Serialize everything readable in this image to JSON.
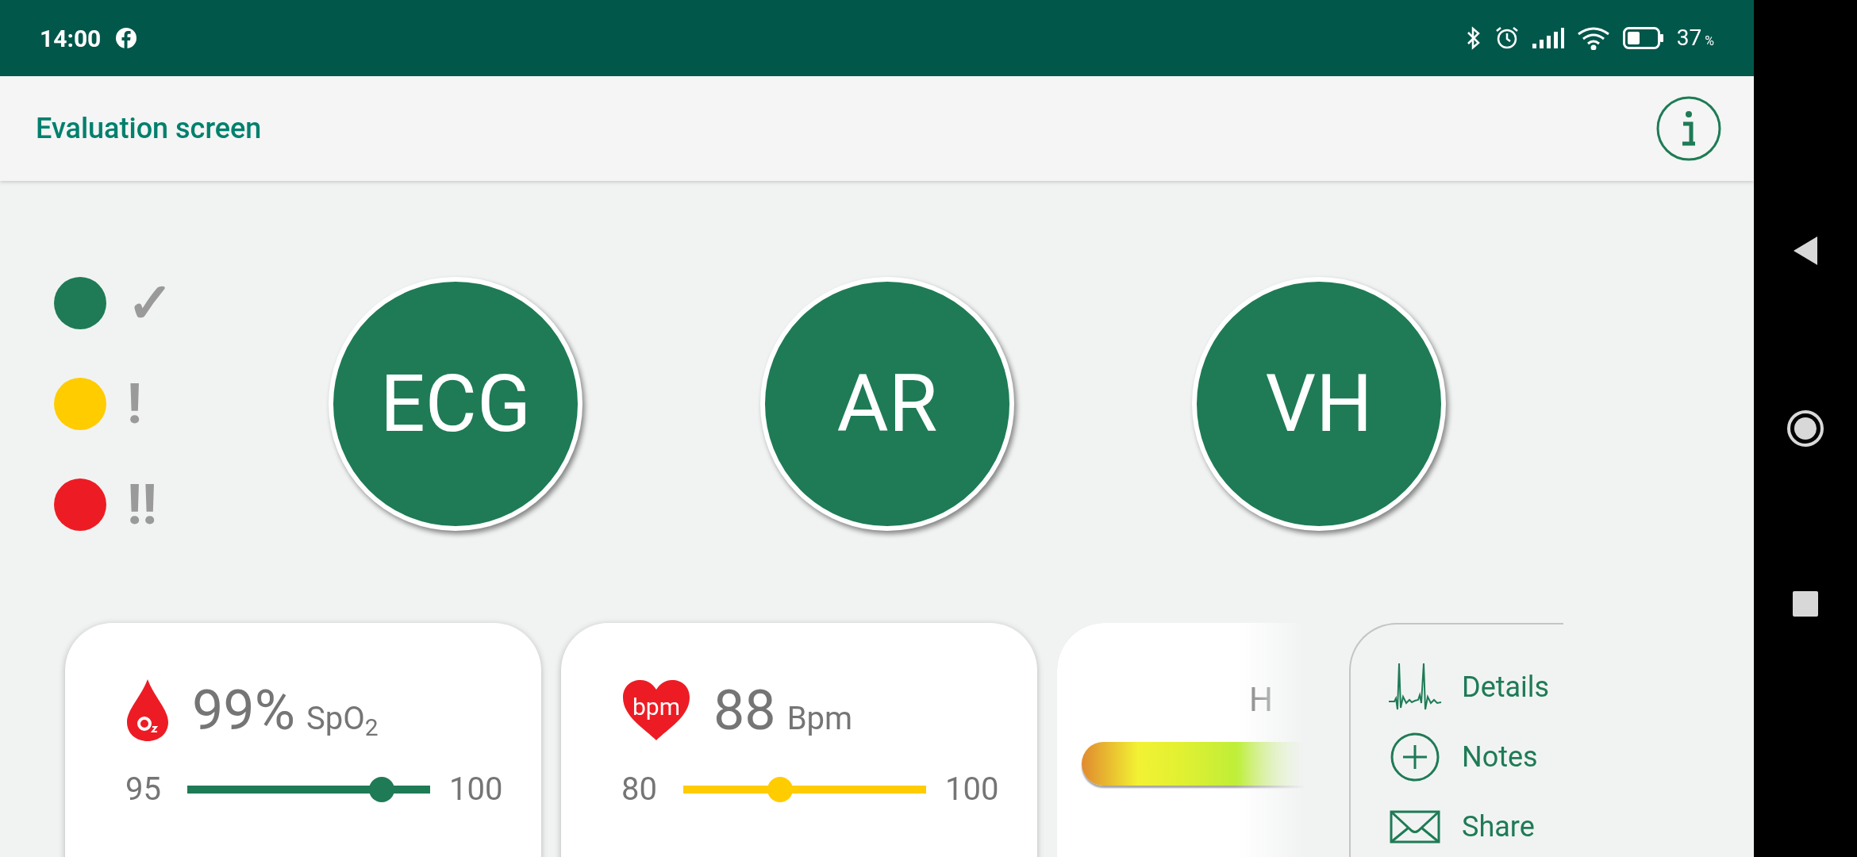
{
  "status_bar": {
    "time": "14:00",
    "battery": "37",
    "battery_unit": "%"
  },
  "app_bar": {
    "title": "Evaluation screen"
  },
  "legend": [
    {
      "color": "#1e7b56",
      "symbol": "✓"
    },
    {
      "color": "#ffcc00",
      "symbol": "!"
    },
    {
      "color": "#ed1c24",
      "symbol": "!!"
    }
  ],
  "indicators": [
    {
      "label": "ECG"
    },
    {
      "label": "AR"
    },
    {
      "label": "VH"
    }
  ],
  "cards": [
    {
      "kind": "oxygen",
      "value": "99%",
      "unit": "SpO$_{2}$",
      "min": "95",
      "max": "100",
      "level": 0.8,
      "color": "#1e7b56"
    },
    {
      "kind": "pulse",
      "icon_text": "bpm",
      "value": "88",
      "unit": "Bpm",
      "min": "80",
      "max": "100",
      "level": 0.4,
      "color": "#ffcc00"
    },
    {
      "kind": "bar",
      "label": "H"
    }
  ],
  "menu": [
    {
      "kind": "ecg",
      "label": "Details"
    },
    {
      "kind": "plus",
      "label": "Notes"
    },
    {
      "kind": "mail",
      "label": "Share"
    }
  ]
}
